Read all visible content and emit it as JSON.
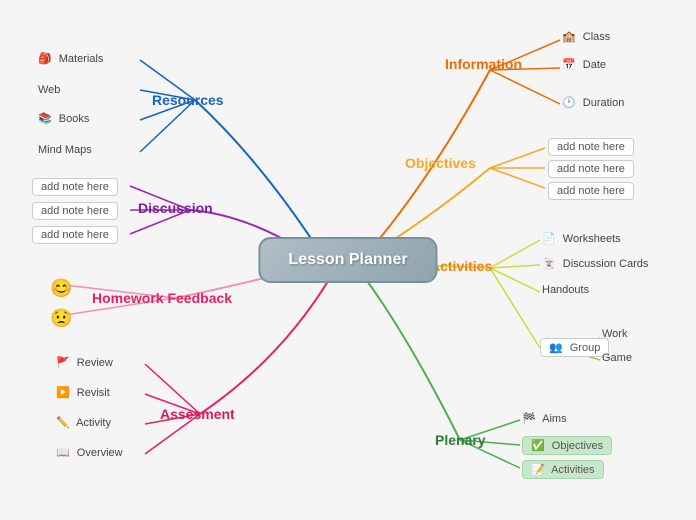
{
  "center": {
    "label": "Lesson Planner"
  },
  "branches": {
    "information": {
      "label": "Information",
      "items": [
        "Class",
        "Date",
        "Duration"
      ]
    },
    "objectives": {
      "label": "Objectives",
      "items": [
        "add note here",
        "add note here",
        "add note here"
      ]
    },
    "activities": {
      "label": "Activities",
      "items": [
        "Worksheets",
        "Discussion Cards",
        "Handouts"
      ],
      "group": {
        "label": "Group",
        "subitems": [
          "Work",
          "Game"
        ]
      }
    },
    "plenary": {
      "label": "Plenary",
      "items": [
        "Aims",
        "Objectives",
        "Activities"
      ]
    },
    "assesment": {
      "label": "Assesment",
      "items": [
        "Review",
        "Revisit",
        "Activity",
        "Overview"
      ]
    },
    "homework": {
      "label": "Homework Feedback",
      "items": [
        "😊",
        "😟"
      ]
    },
    "discussion": {
      "label": "Discussion",
      "items": [
        "add note here",
        "add note here",
        "add note here"
      ]
    },
    "resources": {
      "label": "Resources",
      "items": [
        "Materials",
        "Web",
        "Books",
        "Mind Maps"
      ]
    }
  }
}
